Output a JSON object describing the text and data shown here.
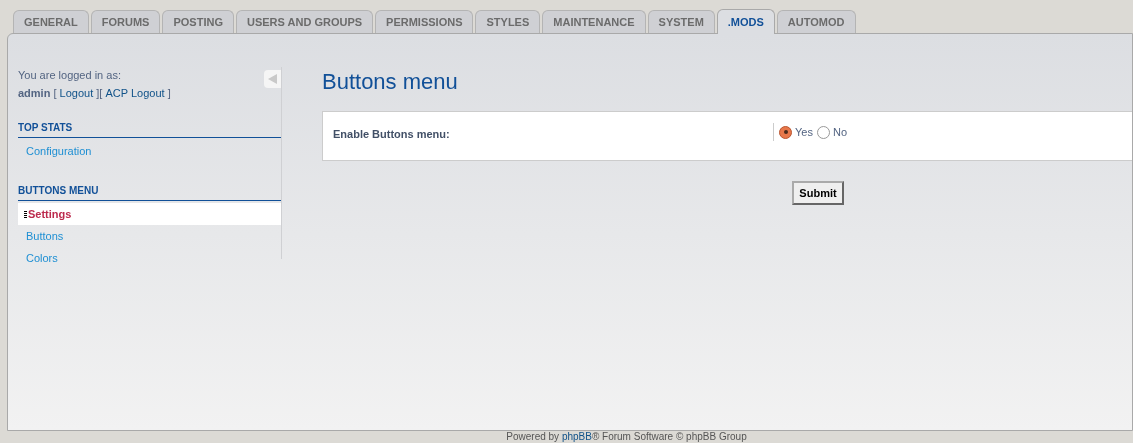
{
  "tabs": [
    {
      "label": "GENERAL",
      "selected": false
    },
    {
      "label": "FORUMS",
      "selected": false
    },
    {
      "label": "POSTING",
      "selected": false
    },
    {
      "label": "USERS AND GROUPS",
      "selected": false
    },
    {
      "label": "PERMISSIONS",
      "selected": false
    },
    {
      "label": "STYLES",
      "selected": false
    },
    {
      "label": "MAINTENANCE",
      "selected": false
    },
    {
      "label": "SYSTEM",
      "selected": false
    },
    {
      "label": ".MODS",
      "selected": true
    },
    {
      "label": "AUTOMOD",
      "selected": false
    }
  ],
  "sidebar": {
    "login_label": "You are logged in as:",
    "user": "admin",
    "logout_links": [
      {
        "pre": "[ ",
        "label": "Logout",
        "post": " ]"
      },
      {
        "pre": "[ ",
        "label": "ACP Logout",
        "post": " ]"
      }
    ],
    "sections": [
      {
        "title": "TOP STATS",
        "items": [
          {
            "label": "Configuration",
            "selected": false
          }
        ]
      },
      {
        "title": "BUTTONS MENU",
        "items": [
          {
            "label": "Settings",
            "selected": true
          },
          {
            "label": "Buttons",
            "selected": false
          },
          {
            "label": "Colors",
            "selected": false
          }
        ]
      }
    ]
  },
  "main": {
    "title": "Buttons menu",
    "settings": [
      {
        "label": "Enable Buttons menu:",
        "options": [
          {
            "label": "Yes",
            "selected": true
          },
          {
            "label": "No",
            "selected": false
          }
        ]
      }
    ],
    "submit": "Submit"
  },
  "footer": {
    "pre": "Powered by ",
    "link": "phpBB",
    "post": "® Forum Software © phpBB Group"
  }
}
